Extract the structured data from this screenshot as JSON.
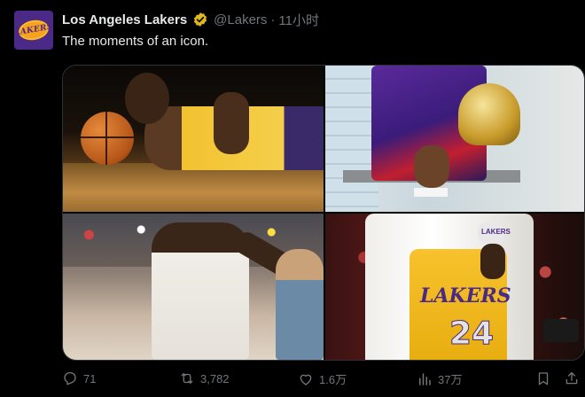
{
  "account": {
    "name": "Los Angeles Lakers",
    "handle": "@Lakers",
    "separator": "·",
    "time": "11小时",
    "avatar_logo_text": "LAKERS"
  },
  "tweet": {
    "text": "The moments of an icon."
  },
  "media": {
    "photo4_jersey_text": "LAKERS",
    "photo4_number": "24",
    "photo4_mic_label": "LAKERS"
  },
  "actions": {
    "replies": "71",
    "retweets": "3,782",
    "likes": "1.6万",
    "views": "37万"
  },
  "icons": {
    "verified": "verified-badge-icon",
    "reply": "reply-icon",
    "retweet": "retweet-icon",
    "like": "heart-icon",
    "views": "views-chart-icon",
    "bookmark": "bookmark-icon",
    "share": "share-icon"
  },
  "colors": {
    "background": "#000000",
    "text": "#e7e9ea",
    "muted": "#71767b",
    "verified_gold": "#e2b719",
    "lakers_purple": "#552583",
    "lakers_gold": "#fdb927"
  }
}
